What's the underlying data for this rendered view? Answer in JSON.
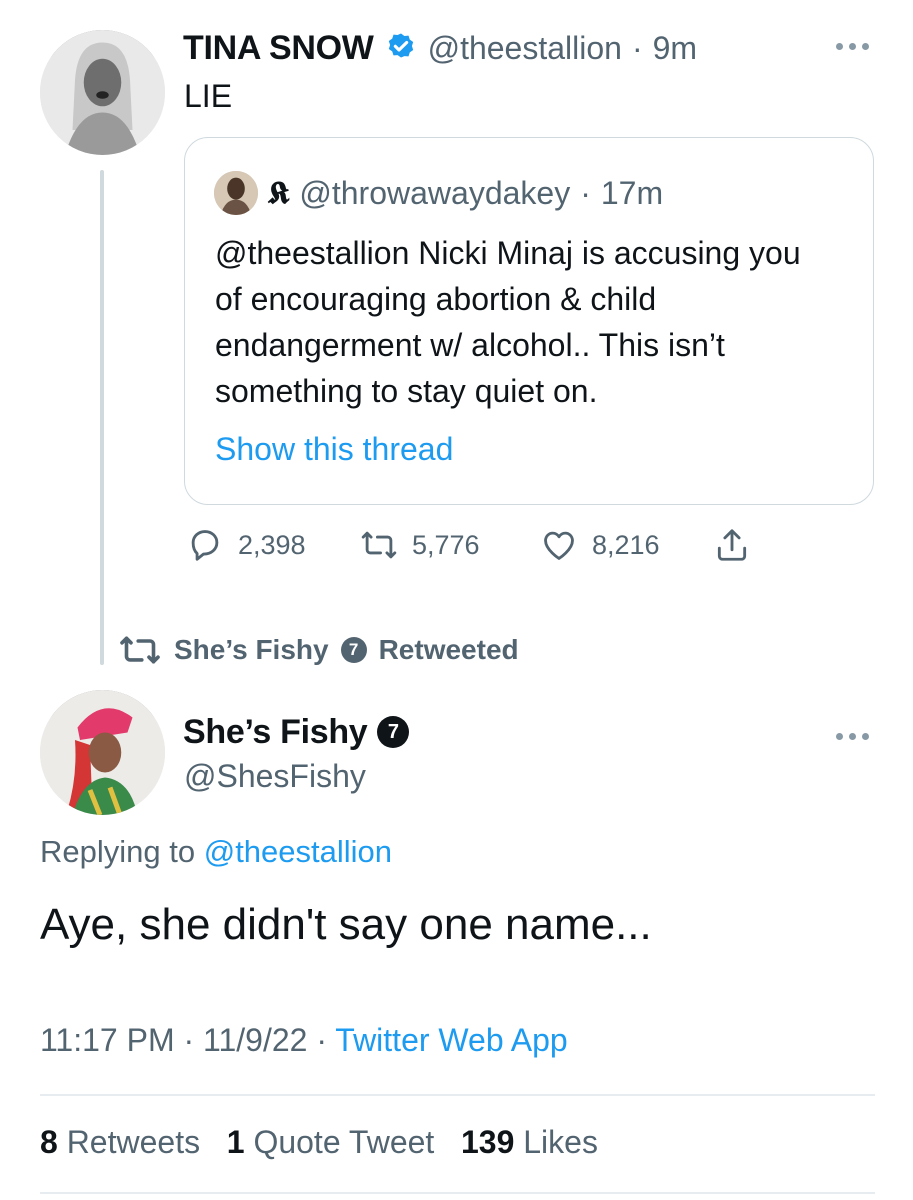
{
  "tweet1": {
    "display_name": "TINA SNOW",
    "handle": "@theestallion",
    "time": "9m",
    "text": "LIE",
    "verified_icon": "verified-badge-icon"
  },
  "quoted": {
    "name_glyph": "𝕶",
    "handle": "@throwawaydakey",
    "time": "17m",
    "text": "@theestallion Nicki Minaj is accusing you of encouraging abortion & child endangerment w/ alcohol.. This isn’t something to stay quiet on.",
    "show_thread": "Show this thread"
  },
  "actions": {
    "replies": "2,398",
    "retweets": "5,776",
    "likes": "8,216"
  },
  "retweet_context": {
    "name": "She’s Fishy",
    "label": "Retweeted",
    "badge": "7"
  },
  "tweet2": {
    "display_name": "She’s Fishy",
    "badge": "7",
    "handle": "@ShesFishy",
    "replying_prefix": "Replying to",
    "replying_to": "@theestallion",
    "text": "Aye, she didn't say one name...",
    "time": "11:17 PM",
    "date": "11/9/22",
    "source": "Twitter Web App",
    "retweets_count": "8",
    "retweets_label": "Retweets",
    "quotes_count": "1",
    "quotes_label": "Quote Tweet",
    "likes_count": "139",
    "likes_label": "Likes"
  },
  "colors": {
    "accent": "#1d9bf0",
    "muted": "#536471",
    "text": "#0f1419",
    "border": "#cfd9de"
  }
}
